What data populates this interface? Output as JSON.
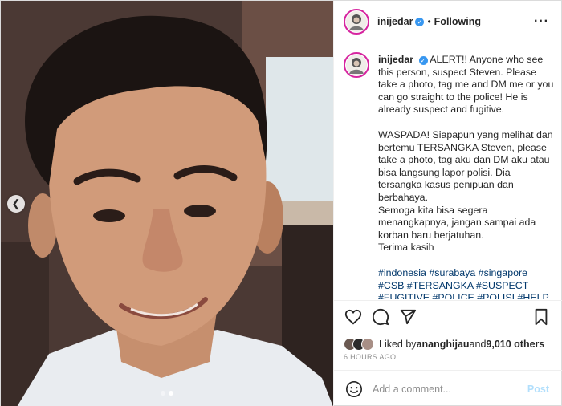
{
  "post": {
    "username": "inijedar",
    "follow_status": "Following",
    "more_icon": "more-options-icon",
    "separator": "•"
  },
  "caption": {
    "username": "inijedar",
    "paragraph1": "ALERT!! Anyone who see this person, suspect Steven. Please take a photo, tag me and DM me or you can go straight to the police! He is already suspect and fugitive.",
    "paragraph2": "WASPADA! Siapapun yang melihat dan bertemu TERSANGKA Steven, please take a photo, tag aku dan DM aku atau bisa langsung lapor polisi. Dia tersangka kasus penipuan dan berbahaya.\nSemoga kita bisa segera menangkapnya, jangan sampai ada korban baru berjatuhan.\nTerima kasih",
    "hashtags": "#indonesia #surabaya #singapore #CSB #TERSANGKA #SUSPECT #FUGITIVE #POLICE #POLISI #HELP"
  },
  "likes": {
    "prefix": "Liked by ",
    "user": "ananghijau",
    "middle": " and ",
    "count": "9,010 others"
  },
  "timestamp": "6 HOURS AGO",
  "comment": {
    "placeholder": "Add a comment...",
    "post_label": "Post"
  },
  "carousel": {
    "total": 2,
    "active_index": 1
  },
  "colors": {
    "link": "#00376b",
    "verified": "#3897f0",
    "story_ring": "#d6249f",
    "post_disabled": "#b2dffc"
  }
}
